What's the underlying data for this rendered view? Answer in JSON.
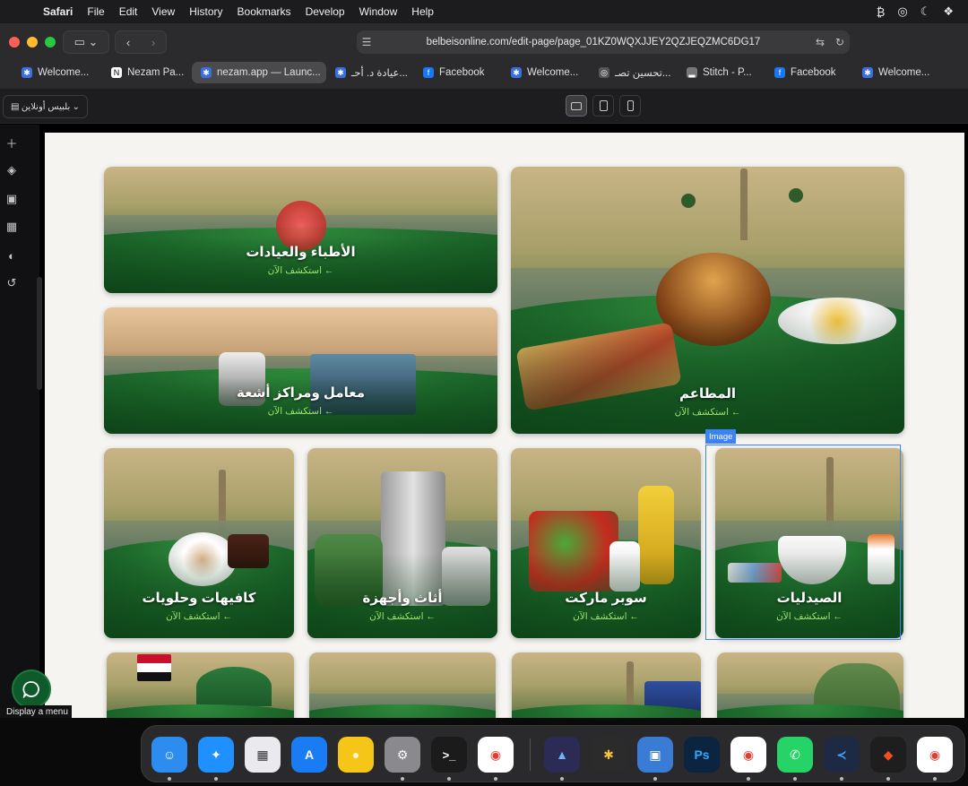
{
  "menubar": {
    "apple": "",
    "items": [
      "Safari",
      "File",
      "Edit",
      "View",
      "History",
      "Bookmarks",
      "Develop",
      "Window",
      "Help"
    ]
  },
  "browser": {
    "url": "belbeisonline.com/edit-page/page_01KZ0WQXJJEY2QZJEQZMC6DG17",
    "tabs": [
      {
        "label": "Welcome...",
        "icon": "blue"
      },
      {
        "label": "Nezam Pa...",
        "icon": "notion"
      },
      {
        "label": "nezam.app — Launc...",
        "icon": "blue"
      },
      {
        "label": "عيادة د. أحـ...",
        "icon": "blue"
      },
      {
        "label": "Facebook",
        "icon": "facebook"
      },
      {
        "label": "Welcome...",
        "icon": "blue"
      },
      {
        "label": "تحسين تصـ...",
        "icon": "openai"
      },
      {
        "label": "Stitch - P...",
        "icon": "stitch"
      },
      {
        "label": "Facebook",
        "icon": "facebook"
      },
      {
        "label": "Welcome...",
        "icon": "blue"
      }
    ]
  },
  "editor": {
    "page_selector": "بلبيس أونلاين"
  },
  "cards": [
    {
      "title": "الأطباء والعيادات",
      "cta": "استكشف الآن ←",
      "theme": "clinic"
    },
    {
      "title": "المطاعم",
      "cta": "استكشف الآن ←",
      "theme": "restaurant"
    },
    {
      "title": "معامل ومراكز أشعة",
      "cta": "استكشف الآن ←",
      "theme": "labs"
    },
    {
      "title": "كافيهات وحلويات",
      "cta": "استكشف الآن ←",
      "theme": "cafe"
    },
    {
      "title": "أثاث وأجهزة",
      "cta": "استكشف الآن ←",
      "theme": "furniture"
    },
    {
      "title": "سوبر ماركت",
      "cta": "استكشف الآن ←",
      "theme": "market"
    },
    {
      "title": "الصيدليات",
      "cta": "استكشف الآن ←",
      "theme": "pharmacy"
    },
    {
      "title": "",
      "cta": "",
      "theme": "mosque"
    },
    {
      "title": "",
      "cta": "",
      "theme": "field"
    },
    {
      "title": "",
      "cta": "",
      "theme": "shop"
    },
    {
      "title": "",
      "cta": "",
      "theme": "backpack"
    }
  ],
  "selection": {
    "label": "Image"
  },
  "tooltip": "Display a menu",
  "dock": [
    {
      "name": "Finder",
      "glyph": "☺",
      "color": "#2d8cf0"
    },
    {
      "name": "Safari",
      "glyph": "✦",
      "color": "#1e90ff"
    },
    {
      "name": "Launchpad",
      "glyph": "▦",
      "color": "#e9e9ee"
    },
    {
      "name": "App Store",
      "glyph": "A",
      "color": "#1a7cf5"
    },
    {
      "name": "Notes",
      "glyph": "●",
      "color": "#f5c518"
    },
    {
      "name": "System Settings",
      "glyph": "⚙",
      "color": "#8a8a8e"
    },
    {
      "name": "Terminal",
      "glyph": ">_",
      "color": "#1b1b1b"
    },
    {
      "name": "Chrome",
      "glyph": "◉",
      "color": "#ffffff"
    },
    {
      "name": "Affinity",
      "glyph": "▲",
      "color": "#2b2b55"
    },
    {
      "name": "Keys",
      "glyph": "✱",
      "color": "#2b2b2b"
    },
    {
      "name": "Database",
      "glyph": "▣",
      "color": "#3a7bd5"
    },
    {
      "name": "Photoshop",
      "glyph": "Ps",
      "color": "#0b2440"
    },
    {
      "name": "Chrome",
      "glyph": "◉",
      "color": "#ffffff"
    },
    {
      "name": "WhatsApp",
      "glyph": "✆",
      "color": "#25d366"
    },
    {
      "name": "VS Code",
      "glyph": "≺",
      "color": "#1e2a44"
    },
    {
      "name": "Figma",
      "glyph": "◆",
      "color": "#1e1e1e"
    },
    {
      "name": "Chrome",
      "glyph": "◉",
      "color": "#ffffff"
    }
  ]
}
